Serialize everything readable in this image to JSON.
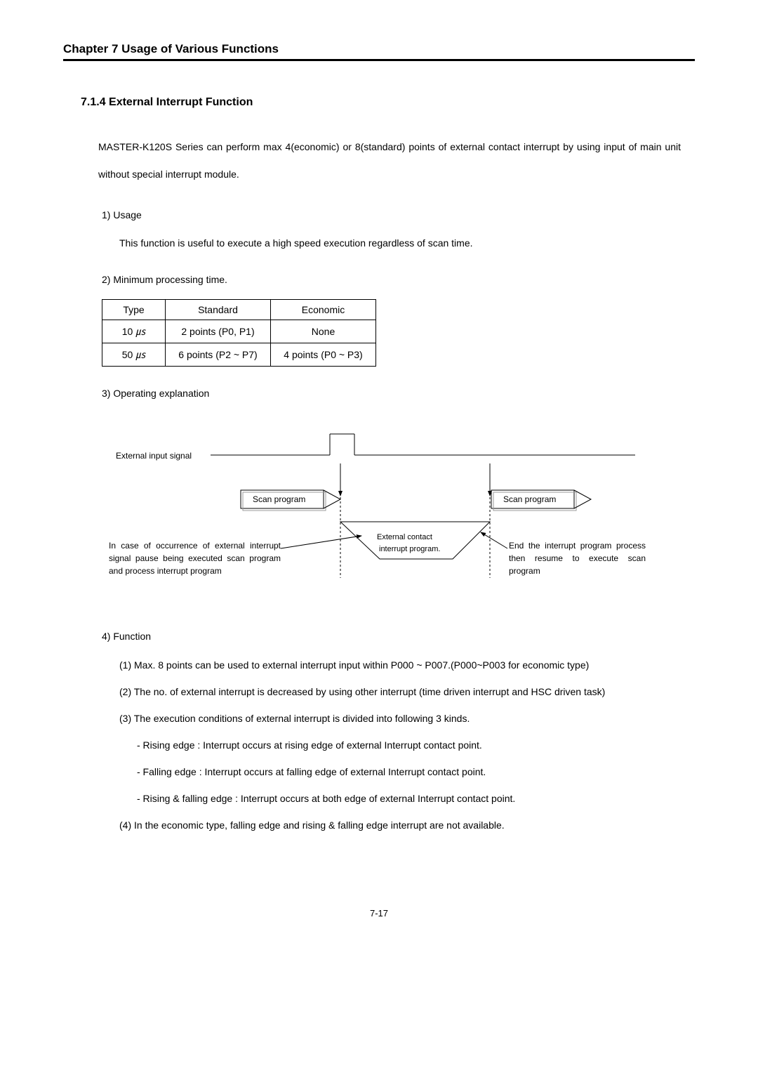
{
  "chapter_header": "Chapter 7    Usage of Various Functions",
  "section_title": "7.1.4 External Interrupt Function",
  "intro": "MASTER-K120S Series can perform max 4(economic) or 8(standard) points of external contact interrupt by using input of main unit without special interrupt module.",
  "sub1": {
    "head": "1) Usage",
    "body": "This function is useful to execute a high speed execution regardless of scan time."
  },
  "sub2": {
    "head": "2) Minimum processing time.",
    "table": {
      "r0": {
        "c0": "Type",
        "c1": "Standard",
        "c2": "Economic"
      },
      "r1": {
        "c0_a": "10 ",
        "c0_b": "㎲",
        "c1": "2 points (P0, P1)",
        "c2": "None"
      },
      "r2": {
        "c0_a": "50 ",
        "c0_b": "㎲",
        "c1": "6 points (P2 ~ P7)",
        "c2": "4 points (P0 ~ P3)"
      }
    }
  },
  "sub3": {
    "head": "3) Operating explanation",
    "diagram": {
      "ext_input": "External input signal",
      "scan1": "Scan program",
      "scan2": "Scan program",
      "ext_contact1": "External contact",
      "ext_contact2": "interrupt program.",
      "left_note": "In case of occurrence of external interrupt signal pause being executed scan program and process interrupt program",
      "right_note": "End the interrupt program process then resume to execute scan program"
    }
  },
  "sub4": {
    "head": "4) Function",
    "items": {
      "p1": "(1) Max. 8 points can be used to external interrupt input within P000 ~ P007.(P000~P003 for economic type)",
      "p2": "(2) The no. of external interrupt is decreased by using other interrupt (time driven interrupt and HSC driven task)",
      "p3": "(3) The execution conditions of external interrupt is divided into following 3 kinds.",
      "b1": "- Rising edge : Interrupt occurs at rising edge of external Interrupt contact point.",
      "b2": "- Falling edge : Interrupt occurs at falling edge of external Interrupt contact point.",
      "b3": "- Rising & falling edge : Interrupt occurs at both edge of external Interrupt contact point.",
      "p4": "(4) In the economic type, falling edge and rising & falling edge interrupt are not available."
    }
  },
  "page_num": "7-17"
}
